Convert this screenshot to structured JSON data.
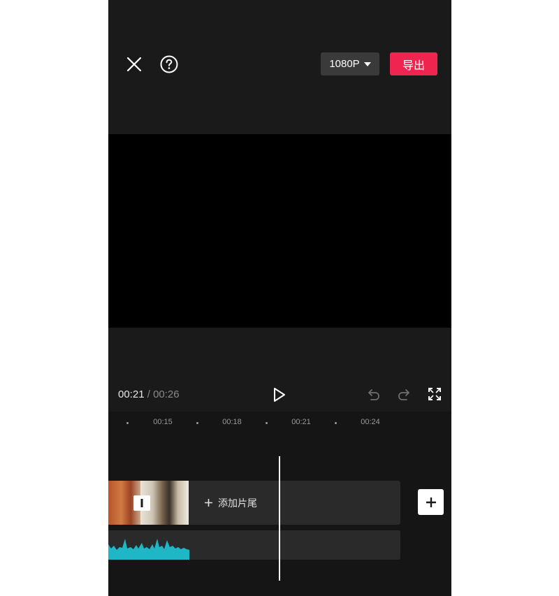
{
  "header": {
    "resolution": "1080P",
    "export_label": "导出"
  },
  "player": {
    "current_time": "00:21",
    "separator": "/",
    "total_time": "00:26"
  },
  "ruler": {
    "ticks": [
      "00:15",
      "00:18",
      "00:21",
      "00:24"
    ]
  },
  "timeline": {
    "add_ending_label": "添加片尾",
    "waveform_color": "#1fb6c6"
  },
  "colors": {
    "accent": "#f0254f",
    "background": "#1a1a1a"
  }
}
